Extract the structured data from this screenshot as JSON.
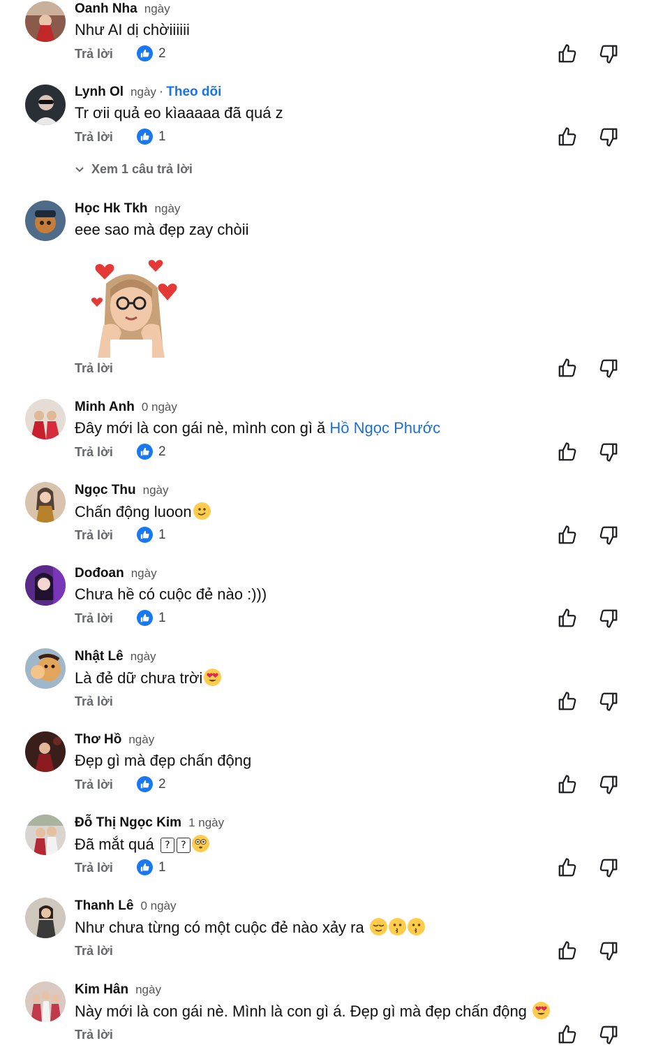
{
  "reply_label": "Trả lời",
  "view_replies_label": "Xem 1 câu trả lời",
  "follow_label": "Theo dõi",
  "comments": [
    {
      "name": "Oanh Nha",
      "time": "ngày",
      "text": "Như AI dị chờiiiiii",
      "likes": "2"
    },
    {
      "name": "Lynh Ol",
      "time": "ngày",
      "text": "Tr ơii quả eo kìaaaaa đã quá z",
      "likes": "1"
    },
    {
      "name": "Học Hk  Tkh",
      "time": "ngày",
      "text": "eee sao mà đẹp zay chòii",
      "likes": ""
    },
    {
      "name": "Minh Anh",
      "time": "0 ngày",
      "text": "Đây mới là con gái nè, mình con gì ă",
      "mention": "Hồ Ngọc Phước",
      "likes": "2"
    },
    {
      "name": "Ngọc Thu",
      "time": "ngày",
      "text": "Chấn động luoon",
      "likes": "1"
    },
    {
      "name": "Dođoan",
      "time": "ngày",
      "text": "Chưa hề có cuộc đẻ nào :)))",
      "likes": "1"
    },
    {
      "name": "Nhật Lê",
      "time": "ngày",
      "text": "Là đẻ dữ chưa trời",
      "likes": ""
    },
    {
      "name": "Thơ Hồ",
      "time": "ngày",
      "text": "Đẹp gì mà đẹp chấn động",
      "likes": "2"
    },
    {
      "name": "Đỗ Thị Ngọc Kim",
      "time": "1 ngày",
      "text": "Đã mắt quá",
      "likes": "1"
    },
    {
      "name": "Thanh Lê",
      "time": "0 ngày",
      "text": "Như chưa từng có một cuộc đẻ nào xảy ra",
      "likes": ""
    },
    {
      "name": "Kim Hân",
      "time": "ngày",
      "text": "Này mới là con gái nè. Mình là con gì á. Đẹp gì mà đẹp chấn động",
      "likes": ""
    }
  ],
  "colors": {
    "like_blue": "#1877f2",
    "link_blue": "#1b74e4",
    "meta_gray": "#65676b"
  }
}
